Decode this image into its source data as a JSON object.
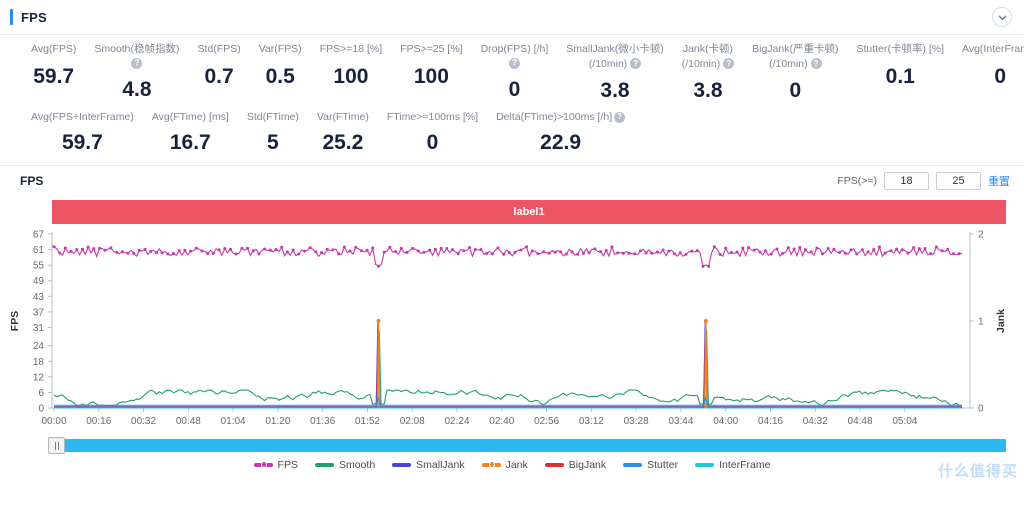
{
  "header": {
    "title": "FPS",
    "collapse_icon": "chevron-down-icon"
  },
  "metrics_row1": [
    {
      "label": "Avg(FPS)",
      "label2": "",
      "help": false,
      "value": "59.7"
    },
    {
      "label": "Smooth(稳帧指数)",
      "label2": "",
      "help": true,
      "value": "4.8"
    },
    {
      "label": "Std(FPS)",
      "label2": "",
      "help": false,
      "value": "0.7"
    },
    {
      "label": "Var(FPS)",
      "label2": "",
      "help": false,
      "value": "0.5"
    },
    {
      "label": "FPS>=18 [%]",
      "label2": "",
      "help": false,
      "value": "100"
    },
    {
      "label": "FPS>=25 [%]",
      "label2": "",
      "help": false,
      "value": "100"
    },
    {
      "label": "Drop(FPS) [/h]",
      "label2": "",
      "help": true,
      "value": "0"
    },
    {
      "label": "SmallJank(微小卡顿)",
      "label2": "(/10min)",
      "help": true,
      "value": "3.8"
    },
    {
      "label": "Jank(卡顿)",
      "label2": "(/10min)",
      "help": true,
      "value": "3.8"
    },
    {
      "label": "BigJank(严重卡顿)",
      "label2": "(/10min)",
      "help": true,
      "value": "0"
    },
    {
      "label": "Stutter(卡顿率) [%]",
      "label2": "",
      "help": false,
      "value": "0.1"
    },
    {
      "label": "Avg(InterFrame)",
      "label2": "",
      "help": false,
      "value": "0"
    }
  ],
  "metrics_row2": [
    {
      "label": "Avg(FPS+InterFrame)",
      "label2": "",
      "help": false,
      "value": "59.7"
    },
    {
      "label": "Avg(FTime) [ms]",
      "label2": "",
      "help": false,
      "value": "16.7"
    },
    {
      "label": "Std(FTime)",
      "label2": "",
      "help": false,
      "value": "5"
    },
    {
      "label": "Var(FTime)",
      "label2": "",
      "help": false,
      "value": "25.2"
    },
    {
      "label": "FTime>=100ms [%]",
      "label2": "",
      "help": false,
      "value": "0"
    },
    {
      "label": "Delta(FTime)>100ms [/h]",
      "label2": "",
      "help": true,
      "value": "22.9"
    }
  ],
  "chart_panel": {
    "title": "FPS",
    "filter_label": "FPS(>=)",
    "input_low": "18",
    "input_high": "25",
    "reset_label": "重置",
    "segment_label": "label1",
    "segment_color": "#ed5565"
  },
  "watermark": "什么值得买",
  "chart_data": {
    "type": "line",
    "title": "FPS",
    "xlabel": "",
    "ylabel": "FPS",
    "y2label": "Jank",
    "grid": false,
    "legend_position": "bottom",
    "ylim": [
      0,
      67
    ],
    "yticks": [
      0,
      6,
      12,
      18,
      24,
      31,
      37,
      43,
      49,
      55,
      61,
      67
    ],
    "y2lim": [
      0,
      2
    ],
    "y2ticks": [
      0,
      1,
      2
    ],
    "xticks": [
      "00:00",
      "00:16",
      "00:32",
      "00:48",
      "01:04",
      "01:20",
      "01:36",
      "01:52",
      "02:08",
      "02:24",
      "02:40",
      "02:56",
      "03:12",
      "03:28",
      "03:44",
      "04:00",
      "04:16",
      "04:32",
      "04:48",
      "05:04"
    ],
    "xlim": [
      "00:00",
      "05:12"
    ],
    "series": [
      {
        "name": "FPS",
        "color": "#c837ab",
        "axis": "left",
        "mean": 59.7,
        "range": [
          54,
          62
        ],
        "dips": [
          {
            "x": "01:52",
            "y": 54
          },
          {
            "x": "03:48",
            "y": 54
          }
        ]
      },
      {
        "name": "Smooth",
        "color": "#22a06b",
        "axis": "left",
        "mean": 4.8,
        "range": [
          1,
          7
        ]
      },
      {
        "name": "SmallJank",
        "color": "#4b46d6",
        "axis": "right",
        "mean": 0,
        "spikes": [
          {
            "x": "01:52",
            "y": 1
          },
          {
            "x": "03:48",
            "y": 1
          }
        ]
      },
      {
        "name": "Jank",
        "color": "#f5811f",
        "axis": "right",
        "mean": 0,
        "spikes": [
          {
            "x": "01:52",
            "y": 1
          },
          {
            "x": "03:48",
            "y": 1
          }
        ]
      },
      {
        "name": "BigJank",
        "color": "#e03131",
        "axis": "right",
        "mean": 0,
        "spikes": []
      },
      {
        "name": "Stutter",
        "color": "#2d8cf0",
        "axis": "right",
        "mean": 0,
        "spikes": [
          {
            "x": "01:52",
            "y": 0.12
          },
          {
            "x": "03:48",
            "y": 0.12
          }
        ]
      },
      {
        "name": "InterFrame",
        "color": "#1ec8d8",
        "axis": "right",
        "mean": 0,
        "spikes": []
      }
    ],
    "legend": [
      {
        "name": "FPS",
        "color": "#c837ab",
        "marker": true
      },
      {
        "name": "Smooth",
        "color": "#22a06b",
        "marker": false
      },
      {
        "name": "SmallJank",
        "color": "#4b46d6",
        "marker": false
      },
      {
        "name": "Jank",
        "color": "#f5811f",
        "marker": true
      },
      {
        "name": "BigJank",
        "color": "#e03131",
        "marker": false
      },
      {
        "name": "Stutter",
        "color": "#2d8cf0",
        "marker": false
      },
      {
        "name": "InterFrame",
        "color": "#1ec8d8",
        "marker": false
      }
    ]
  }
}
